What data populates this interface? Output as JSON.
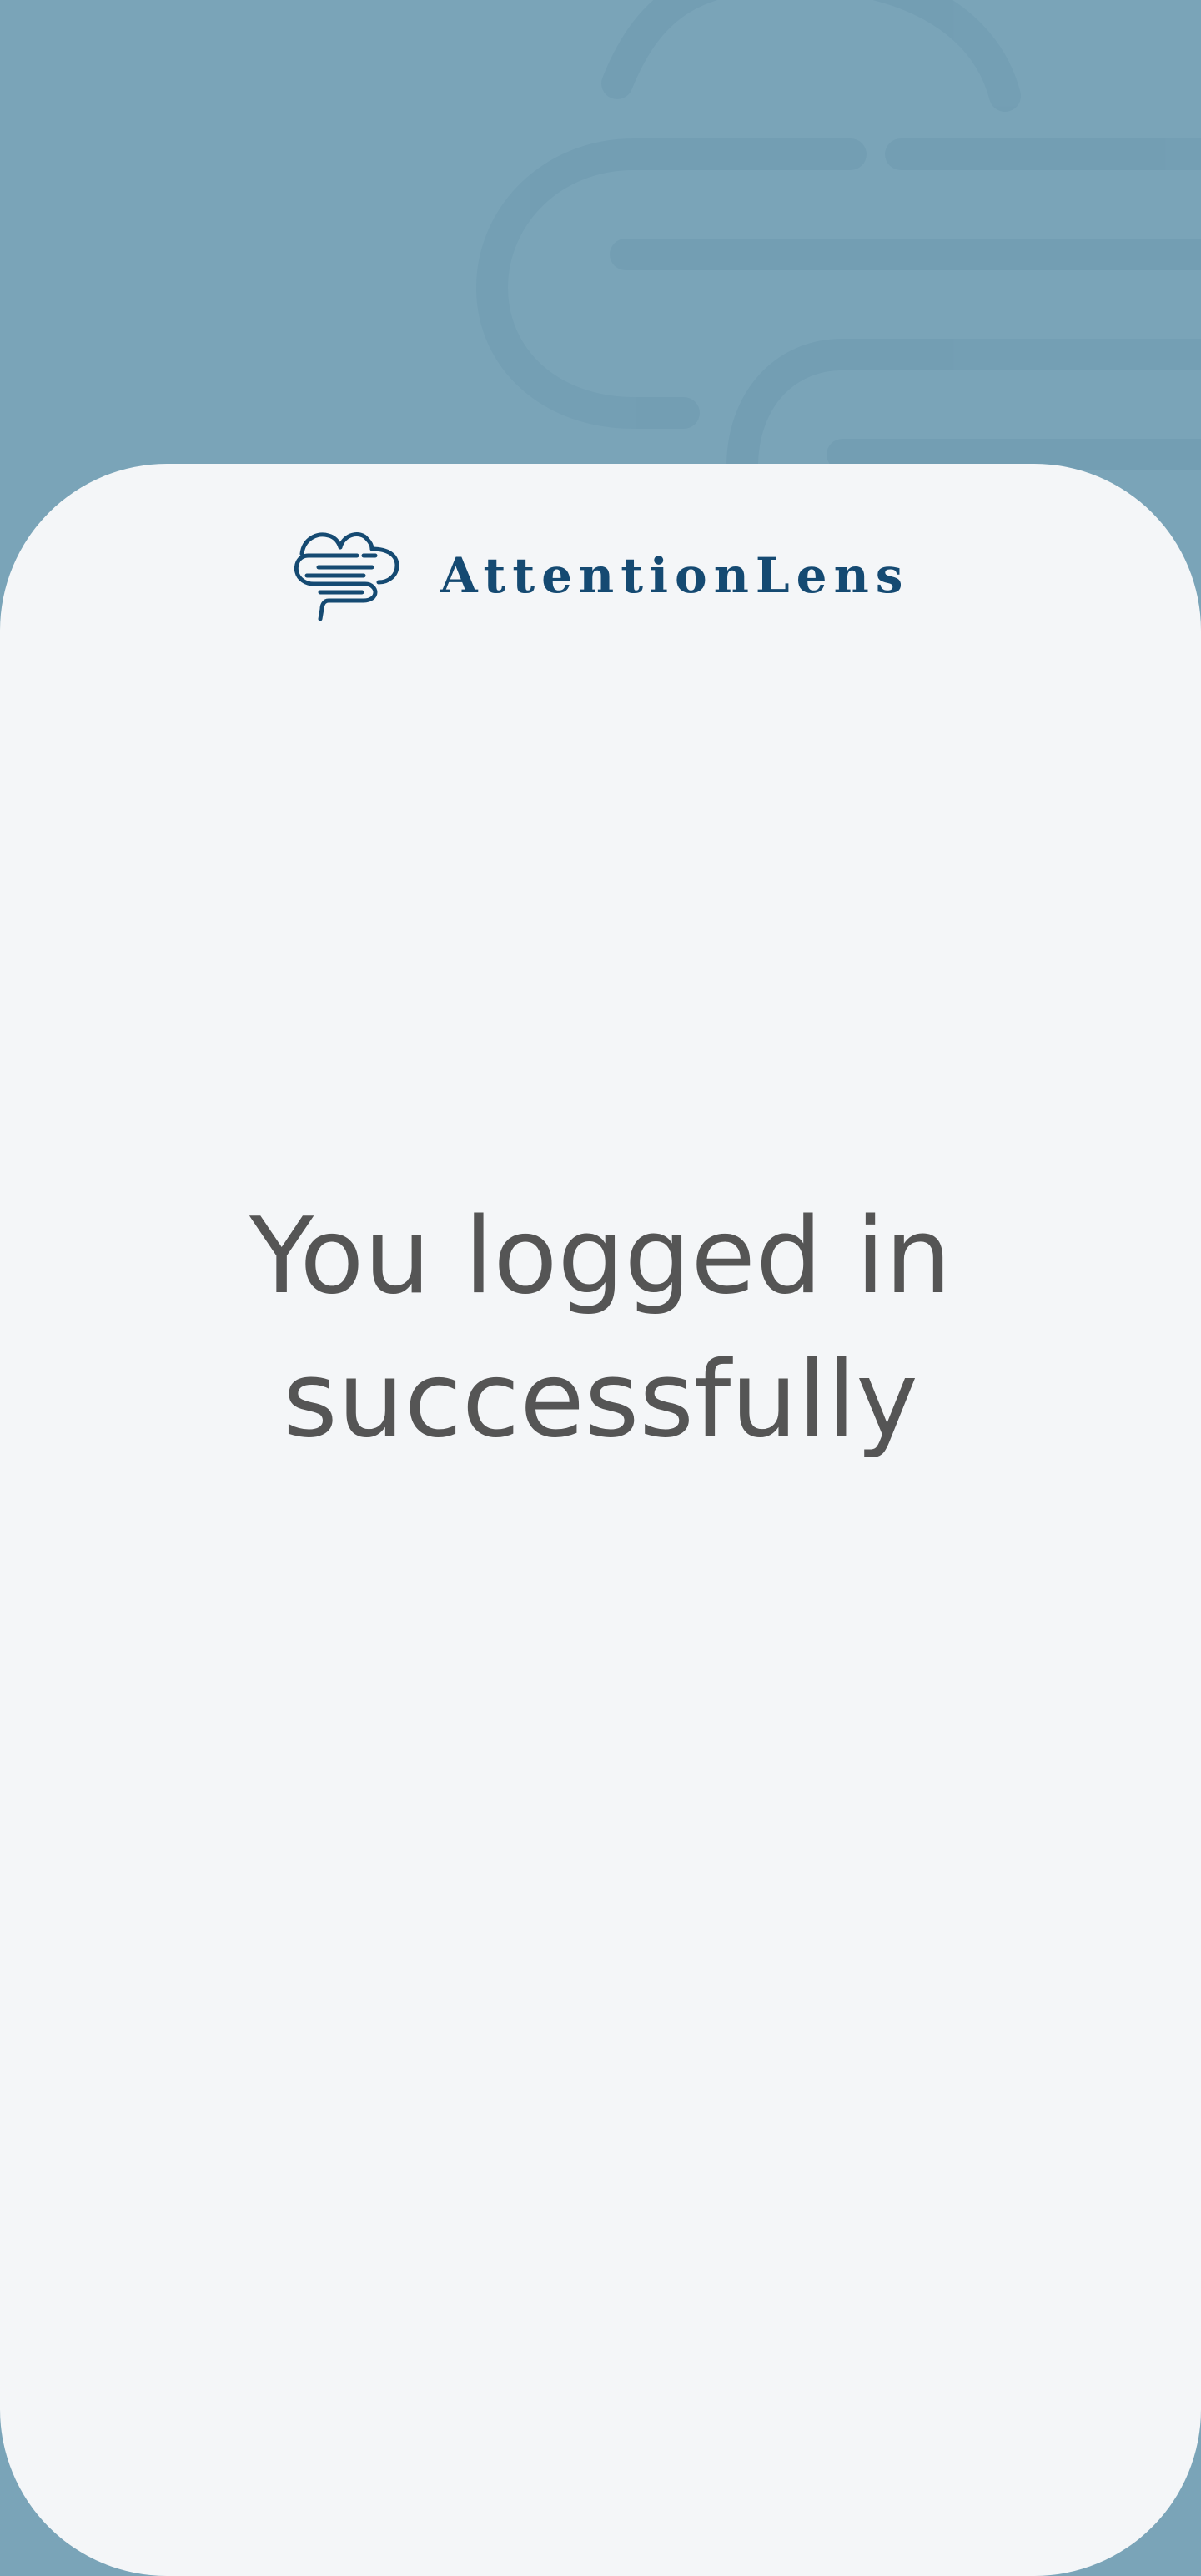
{
  "colors": {
    "background": "#7aa4b8",
    "pattern": "#6f9ab0",
    "card": "#f4f6f8",
    "brand": "#154a72",
    "message_text": "#555555"
  },
  "brand": {
    "logo_icon": "brain-icon",
    "name": "AttentionLens"
  },
  "message": {
    "line1": "You logged in",
    "line2": "successfully"
  }
}
